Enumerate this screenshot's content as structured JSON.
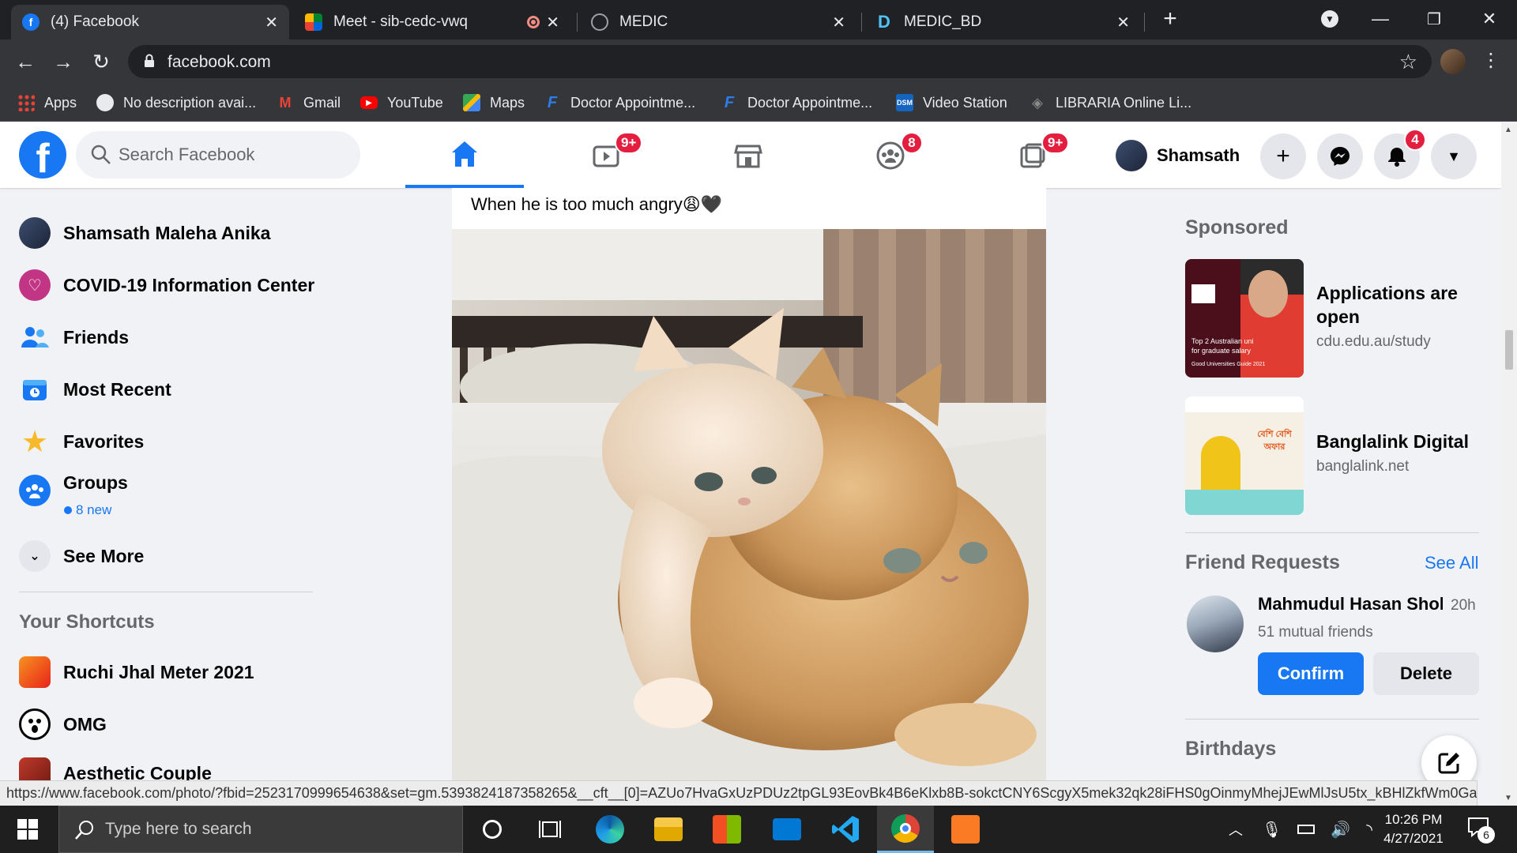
{
  "browser": {
    "tabs": [
      {
        "title": "(4) Facebook",
        "active": true
      },
      {
        "title": "Meet - sib-cedc-vwq",
        "recording": true
      },
      {
        "title": "MEDIC"
      },
      {
        "title": "MEDIC_BD"
      }
    ],
    "new_tab": "+",
    "url": "facebook.com",
    "bookmarks": [
      {
        "label": "Apps"
      },
      {
        "label": "No description avai..."
      },
      {
        "label": "Gmail"
      },
      {
        "label": "YouTube"
      },
      {
        "label": "Maps"
      },
      {
        "label": "Doctor Appointme..."
      },
      {
        "label": "Doctor Appointme..."
      },
      {
        "label": "Video Station"
      },
      {
        "label": "LIBRARIA Online Li..."
      }
    ]
  },
  "fb": {
    "logo": "f",
    "search_placeholder": "Search Facebook",
    "nav_badges": {
      "watch": "9+",
      "groups": "8",
      "gaming": "9+"
    },
    "profile_name": "Shamsath",
    "notifications_count": "4",
    "left_menu": [
      {
        "label": "Shamsath Maleha Anika"
      },
      {
        "label": "COVID-19 Information Center"
      },
      {
        "label": "Friends"
      },
      {
        "label": "Most Recent"
      },
      {
        "label": "Favorites"
      },
      {
        "label": "Groups"
      },
      {
        "label": "See More"
      }
    ],
    "groups_new": "8 new",
    "shortcuts_title": "Your Shortcuts",
    "shortcuts": [
      {
        "label": "Ruchi Jhal Meter 2021"
      },
      {
        "label": "OMG"
      },
      {
        "label": "Aesthetic Couple"
      }
    ],
    "post": {
      "caption": "When he is too much angry😩🖤"
    },
    "sponsored": {
      "title": "Sponsored",
      "ads": [
        {
          "title": "Applications are open",
          "domain": "cdu.edu.au/study",
          "image_text": [
            "Top 2 Australian uni",
            "for graduate salary",
            "Good Universities Guide 2021"
          ]
        },
        {
          "title": "Banglalink Digital",
          "domain": "banglalink.net",
          "image_text": [
            "বেশি বেশি",
            "অফার"
          ]
        }
      ]
    },
    "friend_requests": {
      "title": "Friend Requests",
      "see_all": "See All",
      "name": "Mahmudul Hasan Shoh",
      "time": "20h",
      "mutual": "51 mutual friends",
      "confirm": "Confirm",
      "delete": "Delete"
    },
    "birthdays_title": "Birthdays"
  },
  "status_url": "https://www.facebook.com/photo/?fbid=2523170999654638&set=gm.5393824187358265&__cft__[0]=AZUo7HvaGxUzPDUz2tpGL93EovBk4B6eKlxb8B-sokctCNY6ScgyX5mek32qk28iFHS0gOinmyMhejJEwMlJsU5tx_kBHlZkfWm0Ga5J8X...",
  "taskbar": {
    "search_placeholder": "Type here to search",
    "time": "10:26 PM",
    "date": "4/27/2021",
    "notifications": "6"
  },
  "colors": {
    "fb_blue": "#1877f2",
    "badge_red": "#e41e3f"
  }
}
